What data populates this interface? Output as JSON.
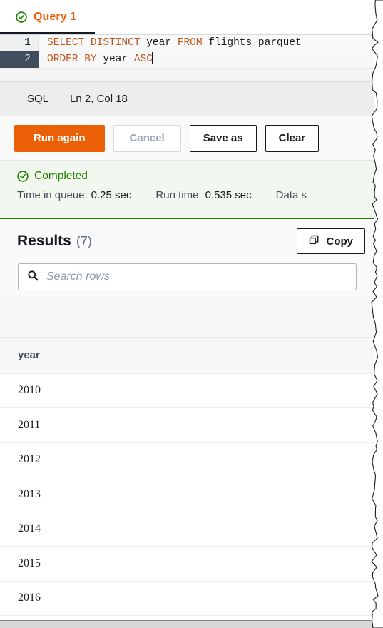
{
  "tab": {
    "label": "Query 1",
    "status_icon": "check-circle-icon",
    "accent_color": "#eb5f07",
    "status_color": "#1d8102"
  },
  "editor": {
    "language": "SQL",
    "cursor_position": "Ln 2, Col 18",
    "active_line": 2,
    "lines": [
      {
        "number": "1",
        "tokens": [
          {
            "text": "SELECT DISTINCT ",
            "type": "keyword"
          },
          {
            "text": "year ",
            "type": "identifier"
          },
          {
            "text": "FROM ",
            "type": "keyword"
          },
          {
            "text": "flights_parquet",
            "type": "identifier"
          }
        ]
      },
      {
        "number": "2",
        "tokens": [
          {
            "text": "ORDER BY ",
            "type": "keyword"
          },
          {
            "text": "year ",
            "type": "identifier"
          },
          {
            "text": "ASC",
            "type": "keyword"
          }
        ]
      }
    ]
  },
  "actions": {
    "run_again": "Run again",
    "cancel": "Cancel",
    "save_as": "Save as",
    "clear": "Clear"
  },
  "banner": {
    "status": "Completed",
    "status_icon": "check-circle-icon",
    "time_in_queue_label": "Time in queue:",
    "time_in_queue_value": "0.25 sec",
    "run_time_label": "Run time:",
    "run_time_value": "0.535 sec",
    "data_scanned_label": "Data s"
  },
  "results": {
    "title": "Results",
    "count": "(7)",
    "copy_label": "Copy",
    "copy_icon": "copy-icon",
    "search_icon": "search-icon",
    "search_placeholder": "Search rows",
    "search_value": "",
    "columns": [
      "year"
    ],
    "rows": [
      [
        "2010"
      ],
      [
        "2011"
      ],
      [
        "2012"
      ],
      [
        "2013"
      ],
      [
        "2014"
      ],
      [
        "2015"
      ],
      [
        "2016"
      ]
    ]
  }
}
